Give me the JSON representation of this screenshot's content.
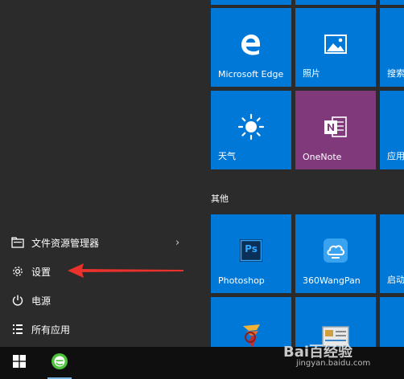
{
  "start_menu": {
    "items": [
      {
        "label": "文件资源管理器",
        "icon": "folder-icon",
        "has_chevron": true,
        "chevron": "›"
      },
      {
        "label": "设置",
        "icon": "gear-icon"
      },
      {
        "label": "电源",
        "icon": "power-icon"
      },
      {
        "label": "所有应用",
        "icon": "list-icon"
      }
    ]
  },
  "tiles": {
    "row1": [
      {
        "label": "Microsoft Edge",
        "icon": "edge-icon",
        "color": "#0078d7"
      },
      {
        "label": "照片",
        "icon": "photos-icon",
        "color": "#0078d7"
      },
      {
        "label": "搜索",
        "icon": "search-icon",
        "color": "#0078d7"
      }
    ],
    "row2": [
      {
        "label": "天气",
        "icon": "sun-icon",
        "color": "#0078d7"
      },
      {
        "label": "OneNote",
        "icon": "onenote-icon",
        "color": "#80397b"
      },
      {
        "label": "应用",
        "icon": "store-icon",
        "color": "#0078d7"
      }
    ],
    "group_other": "其他",
    "row3": [
      {
        "label": "Photoshop",
        "icon": "photoshop-icon",
        "icon_text": "Ps",
        "color": "#0078d7"
      },
      {
        "label": "360WangPan",
        "icon": "cloud-icon",
        "color": "#0078d7"
      },
      {
        "label": "启动",
        "icon": "app-icon",
        "color": "#0078d7"
      }
    ],
    "row4": [
      {
        "label": "",
        "icon": "game-icon",
        "color": "#0078d7"
      },
      {
        "label": "",
        "icon": "card-icon",
        "color": "#0078d7"
      }
    ]
  },
  "taskbar": {
    "start_icon": "windows-icon",
    "apps": [
      {
        "icon": "ie-browser-icon"
      }
    ]
  },
  "watermark": {
    "text": "Bai百经验",
    "url": "jingyan.baidu.com"
  }
}
